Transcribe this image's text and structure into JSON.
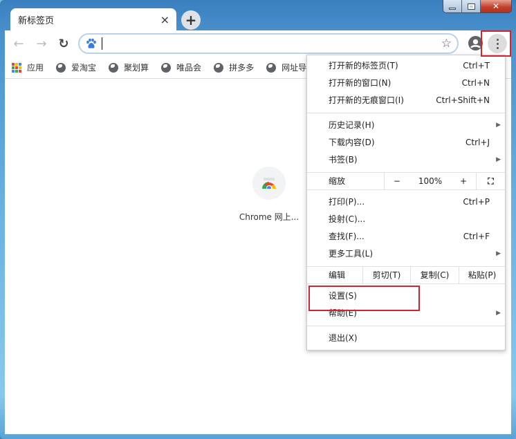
{
  "window": {
    "controls": {
      "minimize": "minimize",
      "maximize": "maximize",
      "close": "close"
    }
  },
  "tab": {
    "title": "新标签页",
    "close_icon": "×",
    "new_tab_icon": "+"
  },
  "toolbar": {
    "back": "←",
    "forward": "→",
    "reload": "↻",
    "omnibox_value": "",
    "star": "☆"
  },
  "bookmarks": [
    {
      "label": "应用",
      "icon": "apps-grid-icon"
    },
    {
      "label": "爱淘宝",
      "icon": "globe-icon"
    },
    {
      "label": "聚划算",
      "icon": "globe-icon"
    },
    {
      "label": "唯品会",
      "icon": "globe-icon"
    },
    {
      "label": "拼多多",
      "icon": "globe-icon"
    },
    {
      "label": "网址导",
      "icon": "globe-icon"
    }
  ],
  "shortcut": {
    "label": "Chrome 网上..."
  },
  "menu": {
    "group1": [
      {
        "label": "打开新的标签页(T)",
        "shortcut": "Ctrl+T"
      },
      {
        "label": "打开新的窗口(N)",
        "shortcut": "Ctrl+N"
      },
      {
        "label": "打开新的无痕窗口(I)",
        "shortcut": "Ctrl+Shift+N"
      }
    ],
    "group2": [
      {
        "label": "历史记录(H)",
        "shortcut": "",
        "submenu": "▶"
      },
      {
        "label": "下载内容(D)",
        "shortcut": "Ctrl+J"
      },
      {
        "label": "书签(B)",
        "shortcut": "",
        "submenu": "▶"
      }
    ],
    "zoom": {
      "label": "缩放",
      "minus": "−",
      "value": "100%",
      "plus": "+",
      "fullscreen": "⛶"
    },
    "group3": [
      {
        "label": "打印(P)...",
        "shortcut": "Ctrl+P"
      },
      {
        "label": "投射(C)...",
        "shortcut": ""
      },
      {
        "label": "查找(F)...",
        "shortcut": "Ctrl+F"
      },
      {
        "label": "更多工具(L)",
        "shortcut": "",
        "submenu": "▶"
      }
    ],
    "edit": {
      "label": "编辑",
      "cut": "剪切(T)",
      "copy": "复制(C)",
      "paste": "粘贴(P)"
    },
    "group4": [
      {
        "label": "设置(S)"
      },
      {
        "label": "帮助(E)",
        "submenu": "▶"
      }
    ],
    "exit": {
      "label": "退出(X)"
    }
  },
  "colors": {
    "highlight": "#d0252f"
  }
}
